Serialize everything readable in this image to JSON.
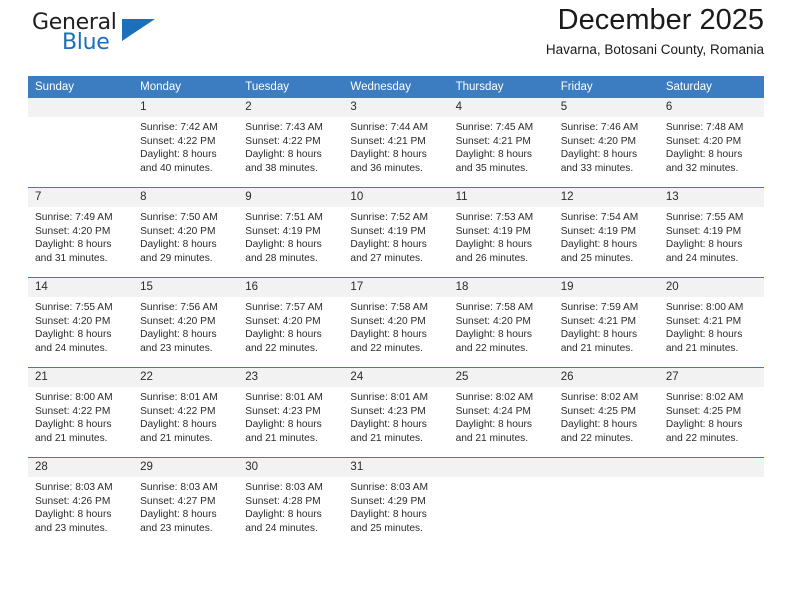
{
  "logo": {
    "text_primary": "General",
    "text_secondary": "Blue",
    "triangle_color": "#1c6fba"
  },
  "header": {
    "title": "December 2025",
    "subtitle": "Havarna, Botosani County, Romania"
  },
  "theme": {
    "header_row_bg": "#3b7dc0",
    "daynum_bg": "#f2f2f2",
    "grid_line": "#3b7dc0",
    "text": "#2b2b2b"
  },
  "columns": [
    "Sunday",
    "Monday",
    "Tuesday",
    "Wednesday",
    "Thursday",
    "Friday",
    "Saturday"
  ],
  "weeks": [
    [
      {
        "day": "",
        "lines": []
      },
      {
        "day": "1",
        "lines": [
          "Sunrise: 7:42 AM",
          "Sunset: 4:22 PM",
          "Daylight: 8 hours",
          "and 40 minutes."
        ]
      },
      {
        "day": "2",
        "lines": [
          "Sunrise: 7:43 AM",
          "Sunset: 4:22 PM",
          "Daylight: 8 hours",
          "and 38 minutes."
        ]
      },
      {
        "day": "3",
        "lines": [
          "Sunrise: 7:44 AM",
          "Sunset: 4:21 PM",
          "Daylight: 8 hours",
          "and 36 minutes."
        ]
      },
      {
        "day": "4",
        "lines": [
          "Sunrise: 7:45 AM",
          "Sunset: 4:21 PM",
          "Daylight: 8 hours",
          "and 35 minutes."
        ]
      },
      {
        "day": "5",
        "lines": [
          "Sunrise: 7:46 AM",
          "Sunset: 4:20 PM",
          "Daylight: 8 hours",
          "and 33 minutes."
        ]
      },
      {
        "day": "6",
        "lines": [
          "Sunrise: 7:48 AM",
          "Sunset: 4:20 PM",
          "Daylight: 8 hours",
          "and 32 minutes."
        ]
      }
    ],
    [
      {
        "day": "7",
        "lines": [
          "Sunrise: 7:49 AM",
          "Sunset: 4:20 PM",
          "Daylight: 8 hours",
          "and 31 minutes."
        ]
      },
      {
        "day": "8",
        "lines": [
          "Sunrise: 7:50 AM",
          "Sunset: 4:20 PM",
          "Daylight: 8 hours",
          "and 29 minutes."
        ]
      },
      {
        "day": "9",
        "lines": [
          "Sunrise: 7:51 AM",
          "Sunset: 4:19 PM",
          "Daylight: 8 hours",
          "and 28 minutes."
        ]
      },
      {
        "day": "10",
        "lines": [
          "Sunrise: 7:52 AM",
          "Sunset: 4:19 PM",
          "Daylight: 8 hours",
          "and 27 minutes."
        ]
      },
      {
        "day": "11",
        "lines": [
          "Sunrise: 7:53 AM",
          "Sunset: 4:19 PM",
          "Daylight: 8 hours",
          "and 26 minutes."
        ]
      },
      {
        "day": "12",
        "lines": [
          "Sunrise: 7:54 AM",
          "Sunset: 4:19 PM",
          "Daylight: 8 hours",
          "and 25 minutes."
        ]
      },
      {
        "day": "13",
        "lines": [
          "Sunrise: 7:55 AM",
          "Sunset: 4:19 PM",
          "Daylight: 8 hours",
          "and 24 minutes."
        ]
      }
    ],
    [
      {
        "day": "14",
        "lines": [
          "Sunrise: 7:55 AM",
          "Sunset: 4:20 PM",
          "Daylight: 8 hours",
          "and 24 minutes."
        ]
      },
      {
        "day": "15",
        "lines": [
          "Sunrise: 7:56 AM",
          "Sunset: 4:20 PM",
          "Daylight: 8 hours",
          "and 23 minutes."
        ]
      },
      {
        "day": "16",
        "lines": [
          "Sunrise: 7:57 AM",
          "Sunset: 4:20 PM",
          "Daylight: 8 hours",
          "and 22 minutes."
        ]
      },
      {
        "day": "17",
        "lines": [
          "Sunrise: 7:58 AM",
          "Sunset: 4:20 PM",
          "Daylight: 8 hours",
          "and 22 minutes."
        ]
      },
      {
        "day": "18",
        "lines": [
          "Sunrise: 7:58 AM",
          "Sunset: 4:20 PM",
          "Daylight: 8 hours",
          "and 22 minutes."
        ]
      },
      {
        "day": "19",
        "lines": [
          "Sunrise: 7:59 AM",
          "Sunset: 4:21 PM",
          "Daylight: 8 hours",
          "and 21 minutes."
        ]
      },
      {
        "day": "20",
        "lines": [
          "Sunrise: 8:00 AM",
          "Sunset: 4:21 PM",
          "Daylight: 8 hours",
          "and 21 minutes."
        ]
      }
    ],
    [
      {
        "day": "21",
        "lines": [
          "Sunrise: 8:00 AM",
          "Sunset: 4:22 PM",
          "Daylight: 8 hours",
          "and 21 minutes."
        ]
      },
      {
        "day": "22",
        "lines": [
          "Sunrise: 8:01 AM",
          "Sunset: 4:22 PM",
          "Daylight: 8 hours",
          "and 21 minutes."
        ]
      },
      {
        "day": "23",
        "lines": [
          "Sunrise: 8:01 AM",
          "Sunset: 4:23 PM",
          "Daylight: 8 hours",
          "and 21 minutes."
        ]
      },
      {
        "day": "24",
        "lines": [
          "Sunrise: 8:01 AM",
          "Sunset: 4:23 PM",
          "Daylight: 8 hours",
          "and 21 minutes."
        ]
      },
      {
        "day": "25",
        "lines": [
          "Sunrise: 8:02 AM",
          "Sunset: 4:24 PM",
          "Daylight: 8 hours",
          "and 21 minutes."
        ]
      },
      {
        "day": "26",
        "lines": [
          "Sunrise: 8:02 AM",
          "Sunset: 4:25 PM",
          "Daylight: 8 hours",
          "and 22 minutes."
        ]
      },
      {
        "day": "27",
        "lines": [
          "Sunrise: 8:02 AM",
          "Sunset: 4:25 PM",
          "Daylight: 8 hours",
          "and 22 minutes."
        ]
      }
    ],
    [
      {
        "day": "28",
        "lines": [
          "Sunrise: 8:03 AM",
          "Sunset: 4:26 PM",
          "Daylight: 8 hours",
          "and 23 minutes."
        ]
      },
      {
        "day": "29",
        "lines": [
          "Sunrise: 8:03 AM",
          "Sunset: 4:27 PM",
          "Daylight: 8 hours",
          "and 23 minutes."
        ]
      },
      {
        "day": "30",
        "lines": [
          "Sunrise: 8:03 AM",
          "Sunset: 4:28 PM",
          "Daylight: 8 hours",
          "and 24 minutes."
        ]
      },
      {
        "day": "31",
        "lines": [
          "Sunrise: 8:03 AM",
          "Sunset: 4:29 PM",
          "Daylight: 8 hours",
          "and 25 minutes."
        ]
      },
      {
        "day": "",
        "lines": []
      },
      {
        "day": "",
        "lines": []
      },
      {
        "day": "",
        "lines": []
      }
    ]
  ]
}
